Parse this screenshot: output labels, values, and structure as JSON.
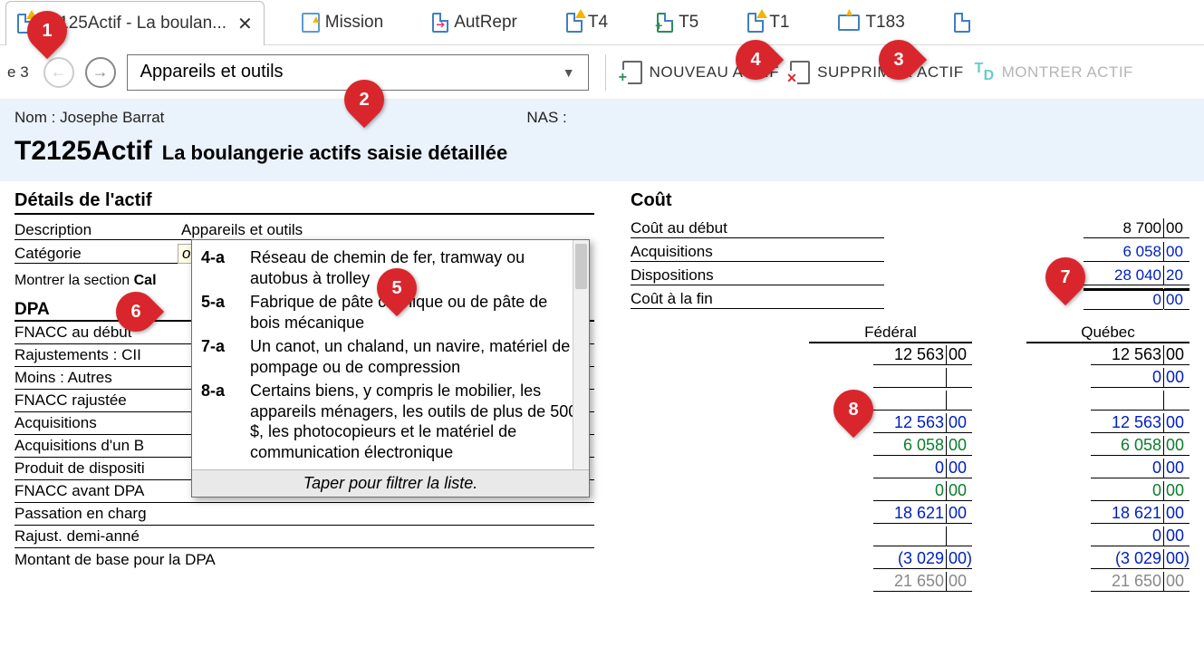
{
  "tabs": {
    "active": "T2125Actif - La boulan...",
    "others": [
      "Mission",
      "AutRepr",
      "T4",
      "T5",
      "T1",
      "T183"
    ]
  },
  "toolbar": {
    "page_num": "3",
    "asset_select": "Appareils et outils",
    "nouveau": "NOUVEAU ACTIF",
    "supprimer": "SUPPRIMER ACTIF",
    "montrer": "MONTRER ACTIF"
  },
  "info": {
    "nom_label": "Nom :",
    "nom_value": "Josephe Barrat",
    "nas_label": "NAS :",
    "title_big": "T2125Actif",
    "title_sub": "La boulangerie actifs saisie détaillée"
  },
  "details": {
    "section": "Détails de l'actif",
    "desc_label": "Description",
    "desc_value": "Appareils et outils",
    "cat_label": "Catégorie",
    "cat_placeholder": "ou",
    "show_link_prefix": "Montrer la section ",
    "show_link_bold": "Cal"
  },
  "dpa": {
    "head": "DPA",
    "rows": [
      "FNACC au début",
      "Rajustements : CII",
      "Moins : Autres",
      "FNACC rajustée",
      "Acquisitions",
      "Acquisitions d'un B",
      "Produit de dispositi",
      "FNACC avant DPA",
      "Passation en charg",
      "Rajust. demi-anné",
      "Montant de base pour la DPA"
    ]
  },
  "cost": {
    "head": "Coût",
    "lines": [
      {
        "label": "Coût au début",
        "whole": "8 700",
        "cents": "00",
        "cls": ""
      },
      {
        "label": "Acquisitions",
        "whole": "6 058",
        "cents": "00",
        "cls": "blue"
      },
      {
        "label": "Dispositions",
        "whole": "28 040",
        "cents": "20",
        "cls": "blue"
      },
      {
        "label": "Coût à la fin",
        "whole": "0",
        "cents": "00",
        "cls": "blue heavy"
      }
    ],
    "col_heads": {
      "fed": "Fédéral",
      "qc": "Québec"
    },
    "grid": [
      {
        "fed": {
          "w": "12 563",
          "c": "00",
          "cls": ""
        },
        "qc": {
          "w": "12 563",
          "c": "00",
          "cls": ""
        }
      },
      {
        "fed": {
          "w": "",
          "c": "",
          "cls": ""
        },
        "qc": {
          "w": "0",
          "c": "00",
          "cls": "blue"
        }
      },
      {
        "fed": {
          "w": "",
          "c": "",
          "cls": ""
        },
        "qc": {
          "w": "",
          "c": "",
          "cls": ""
        }
      },
      {
        "fed": {
          "w": "12 563",
          "c": "00",
          "cls": "blue"
        },
        "qc": {
          "w": "12 563",
          "c": "00",
          "cls": "blue"
        }
      },
      {
        "fed": {
          "w": "6 058",
          "c": "00",
          "cls": "green"
        },
        "qc": {
          "w": "6 058",
          "c": "00",
          "cls": "green"
        }
      },
      {
        "fed": {
          "w": "0",
          "c": "00",
          "cls": "blue"
        },
        "qc": {
          "w": "0",
          "c": "00",
          "cls": "blue"
        }
      },
      {
        "fed": {
          "w": "0",
          "c": "00",
          "cls": "green"
        },
        "qc": {
          "w": "0",
          "c": "00",
          "cls": "green"
        }
      },
      {
        "fed": {
          "w": "18 621",
          "c": "00",
          "cls": "blue"
        },
        "qc": {
          "w": "18 621",
          "c": "00",
          "cls": "blue"
        }
      },
      {
        "fed": {
          "w": "",
          "c": "",
          "cls": ""
        },
        "qc": {
          "w": "0",
          "c": "00",
          "cls": "blue"
        }
      },
      {
        "fed": {
          "w": "(3 029",
          "c": "00)",
          "cls": "blue"
        },
        "qc": {
          "w": "(3 029",
          "c": "00)",
          "cls": "blue"
        }
      },
      {
        "fed": {
          "w": "21 650",
          "c": "00",
          "cls": "gray"
        },
        "qc": {
          "w": "21 650",
          "c": "00",
          "cls": "gray"
        }
      }
    ]
  },
  "dropdown": {
    "options": [
      {
        "code": "4-a",
        "text": "Réseau de chemin de fer, tramway ou autobus à trolley"
      },
      {
        "code": "5-a",
        "text": "Fabrique de pâte chimique ou de pâte de bois mécanique"
      },
      {
        "code": "7-a",
        "text": "Un canot, un chaland, un navire, matériel de pompage ou de compression"
      },
      {
        "code": "8-a",
        "text": "Certains biens, y compris le mobilier, les appareils ménagers, les outils de plus de 500 $, les photocopieurs et le matériel de communication électronique"
      }
    ],
    "footer": "Taper pour filtrer la liste."
  },
  "markers": {
    "m1": "1",
    "m2": "2",
    "m3": "3",
    "m4": "4",
    "m5": "5",
    "m6": "6",
    "m7": "7",
    "m8": "8"
  }
}
